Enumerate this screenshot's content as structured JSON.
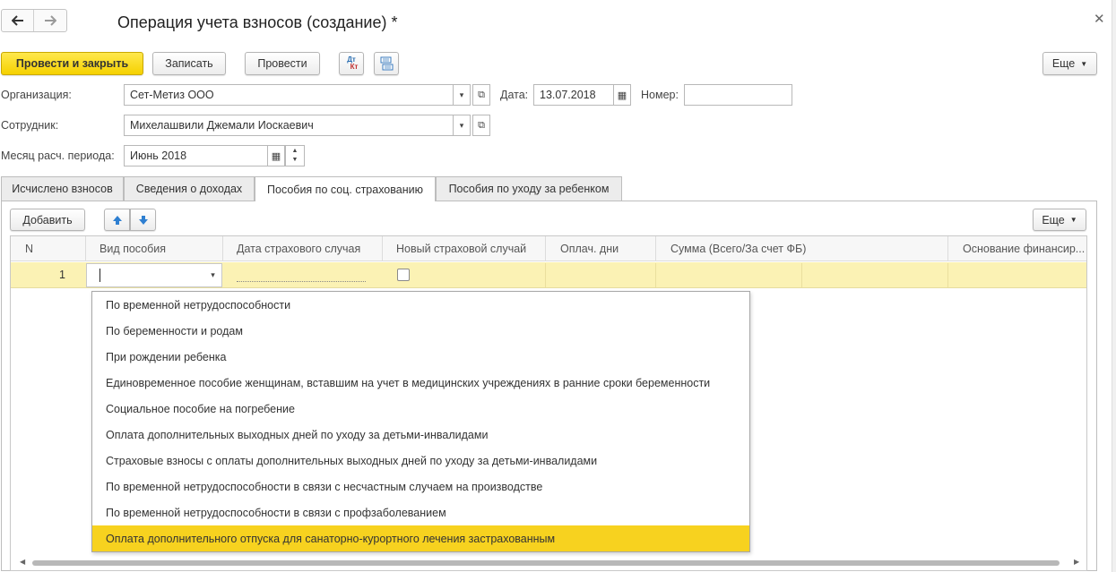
{
  "window": {
    "title": "Операция учета взносов (создание) *"
  },
  "toolbar": {
    "post_close": "Провести и закрыть",
    "save": "Записать",
    "post": "Провести",
    "dt_kt_top": "Дт",
    "dt_kt_bottom": "Кт",
    "more": "Еще"
  },
  "form": {
    "org_label": "Организация:",
    "org_value": "Сет-Метиз ООО",
    "date_label": "Дата:",
    "date_value": "13.07.2018",
    "number_label": "Номер:",
    "number_value": "",
    "employee_label": "Сотрудник:",
    "employee_value": "Михелашвили Джемали Иоскаевич",
    "period_label": "Месяц расч. периода:",
    "period_value": "Июнь 2018"
  },
  "tabs": [
    {
      "label": "Исчислено взносов"
    },
    {
      "label": "Сведения о доходах"
    },
    {
      "label": "Пособия по соц. страхованию"
    },
    {
      "label": "Пособия по уходу за ребенком"
    }
  ],
  "table_toolbar": {
    "add": "Добавить",
    "more": "Еще"
  },
  "table": {
    "columns": [
      "N",
      "Вид пособия",
      "Дата страхового случая",
      "Новый страховой случай",
      "Оплач. дни",
      "Сумма (Всего/За счет ФБ)",
      "Основание финансир..."
    ],
    "rows": [
      {
        "n": "1",
        "benefit_type": "",
        "date": "",
        "new_case": false,
        "paid_days": "",
        "amount": "",
        "basis": ""
      }
    ]
  },
  "dropdown": {
    "items": [
      "По временной нетрудоспособности",
      "По беременности и родам",
      "При рождении ребенка",
      "Единовременное пособие женщинам, вставшим на учет в медицинских учреждениях в ранние сроки беременности",
      "Социальное пособие на погребение",
      "Оплата дополнительных выходных дней по уходу за детьми-инвалидами",
      "Страховые взносы с оплаты дополнительных выходных дней по уходу за детьми-инвалидами",
      "По временной нетрудоспособности в связи с несчастным случаем на производстве",
      "По временной нетрудоспособности в связи с профзаболеванием",
      "Оплата дополнительного отпуска для санаторно-курортного лечения застрахованным"
    ],
    "selected_index": 9
  },
  "colors": {
    "accent": "#f5d100",
    "row_highlight": "#fbf2b4",
    "selection": "#f7d21f"
  }
}
